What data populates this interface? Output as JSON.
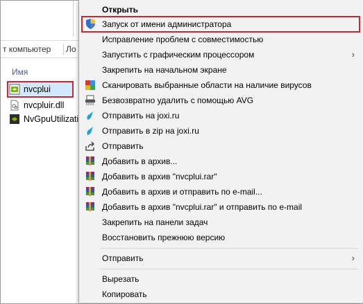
{
  "explorer": {
    "address_text": "т компьютер",
    "address_tail": "Ло",
    "column_header": "Имя",
    "files": [
      "nvcplui",
      "nvcpluir.dll",
      "NvGpuUtilizatio"
    ]
  },
  "menu": {
    "items": [
      {
        "label": "Открыть",
        "icon": "none"
      },
      {
        "label": "Запуск от имени администратора",
        "icon": "uac-shield-icon"
      },
      {
        "label": "Исправление проблем с совместимостью",
        "icon": "none"
      },
      {
        "label": "Запустить с графическим процессором",
        "icon": "none",
        "submenu": true
      },
      {
        "label": "Закрепить на начальном экране",
        "icon": "none"
      },
      {
        "label": "Сканировать выбранные области на наличие вирусов",
        "icon": "avg-scan-icon"
      },
      {
        "label": "Безвозвратно удалить с помощью AVG",
        "icon": "shredder-icon"
      },
      {
        "label": "Отправить на joxi.ru",
        "icon": "joxi-icon"
      },
      {
        "label": "Отправить в zip на joxi.ru",
        "icon": "joxi-icon"
      },
      {
        "label": "Отправить",
        "icon": "share-icon"
      },
      {
        "label": "Добавить в архив...",
        "icon": "winrar-icon"
      },
      {
        "label": "Добавить в архив \"nvcplui.rar\"",
        "icon": "winrar-icon"
      },
      {
        "label": "Добавить в архив и отправить по e-mail...",
        "icon": "winrar-icon"
      },
      {
        "label": "Добавить в архив \"nvcplui.rar\" и отправить по e-mail",
        "icon": "winrar-icon"
      },
      {
        "label": "Закрепить на панели задач",
        "icon": "none"
      },
      {
        "label": "Восстановить прежнюю версию",
        "icon": "none"
      },
      {
        "label": "Отправить",
        "icon": "none",
        "submenu": true
      },
      {
        "label": "Вырезать",
        "icon": "none"
      },
      {
        "label": "Копировать",
        "icon": "none"
      }
    ],
    "submenu_arrow": "›"
  },
  "colors": {
    "highlight_border": "#d0262f",
    "selection_fill": "#d3e8fb",
    "menu_bg": "#f2f2f2"
  }
}
